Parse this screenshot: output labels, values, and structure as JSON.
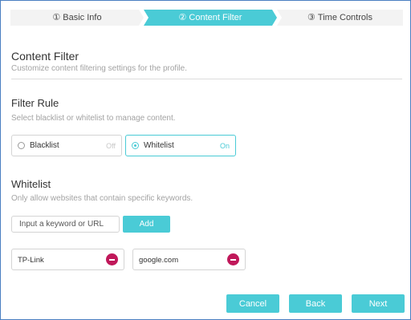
{
  "stepper": {
    "steps": [
      {
        "num": "①",
        "label": "Basic Info"
      },
      {
        "num": "②",
        "label": "Content Filter"
      },
      {
        "num": "③",
        "label": "Time Controls"
      }
    ]
  },
  "header": {
    "title": "Content Filter",
    "subtitle": "Customize content filtering settings for the profile."
  },
  "filter_rule": {
    "title": "Filter Rule",
    "description": "Select blacklist or whitelist to manage content.",
    "options": [
      {
        "label": "Blacklist",
        "state": "Off"
      },
      {
        "label": "Whitelist",
        "state": "On"
      }
    ]
  },
  "whitelist": {
    "title": "Whitelist",
    "description": "Only allow websites that contain specific keywords.",
    "input_placeholder": "Input a keyword or URL",
    "add_label": "Add",
    "entries": [
      "TP-Link",
      "google.com"
    ]
  },
  "footer": {
    "cancel_label": "Cancel",
    "back_label": "Back",
    "next_label": "Next"
  },
  "colors": {
    "accent": "#4acbd6",
    "remove": "#c0185a"
  }
}
